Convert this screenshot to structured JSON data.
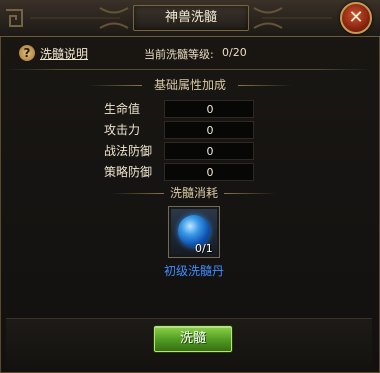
{
  "window": {
    "title": "神兽洗髓"
  },
  "header": {
    "help_label": "洗髓说明",
    "level_label": "当前洗髓等级:",
    "level_value": "0/20"
  },
  "attributes_section": {
    "title": "基础属性加成",
    "rows": [
      {
        "label": "生命值",
        "value": "0"
      },
      {
        "label": "攻击力",
        "value": "0"
      },
      {
        "label": "战法防御",
        "value": "0"
      },
      {
        "label": "策略防御",
        "value": "0"
      }
    ]
  },
  "consume_section": {
    "title": "洗髓消耗",
    "item": {
      "icon": "blue-orb-icon",
      "count": "0/1",
      "name": "初级洗髓丹"
    }
  },
  "actions": {
    "wash_label": "洗髓",
    "close_symbol": "✕"
  },
  "colors": {
    "item_name": "#3f8cff",
    "button_green": "#4f9a21",
    "close_red": "#8a2410",
    "frame_gold": "#7a6540"
  }
}
